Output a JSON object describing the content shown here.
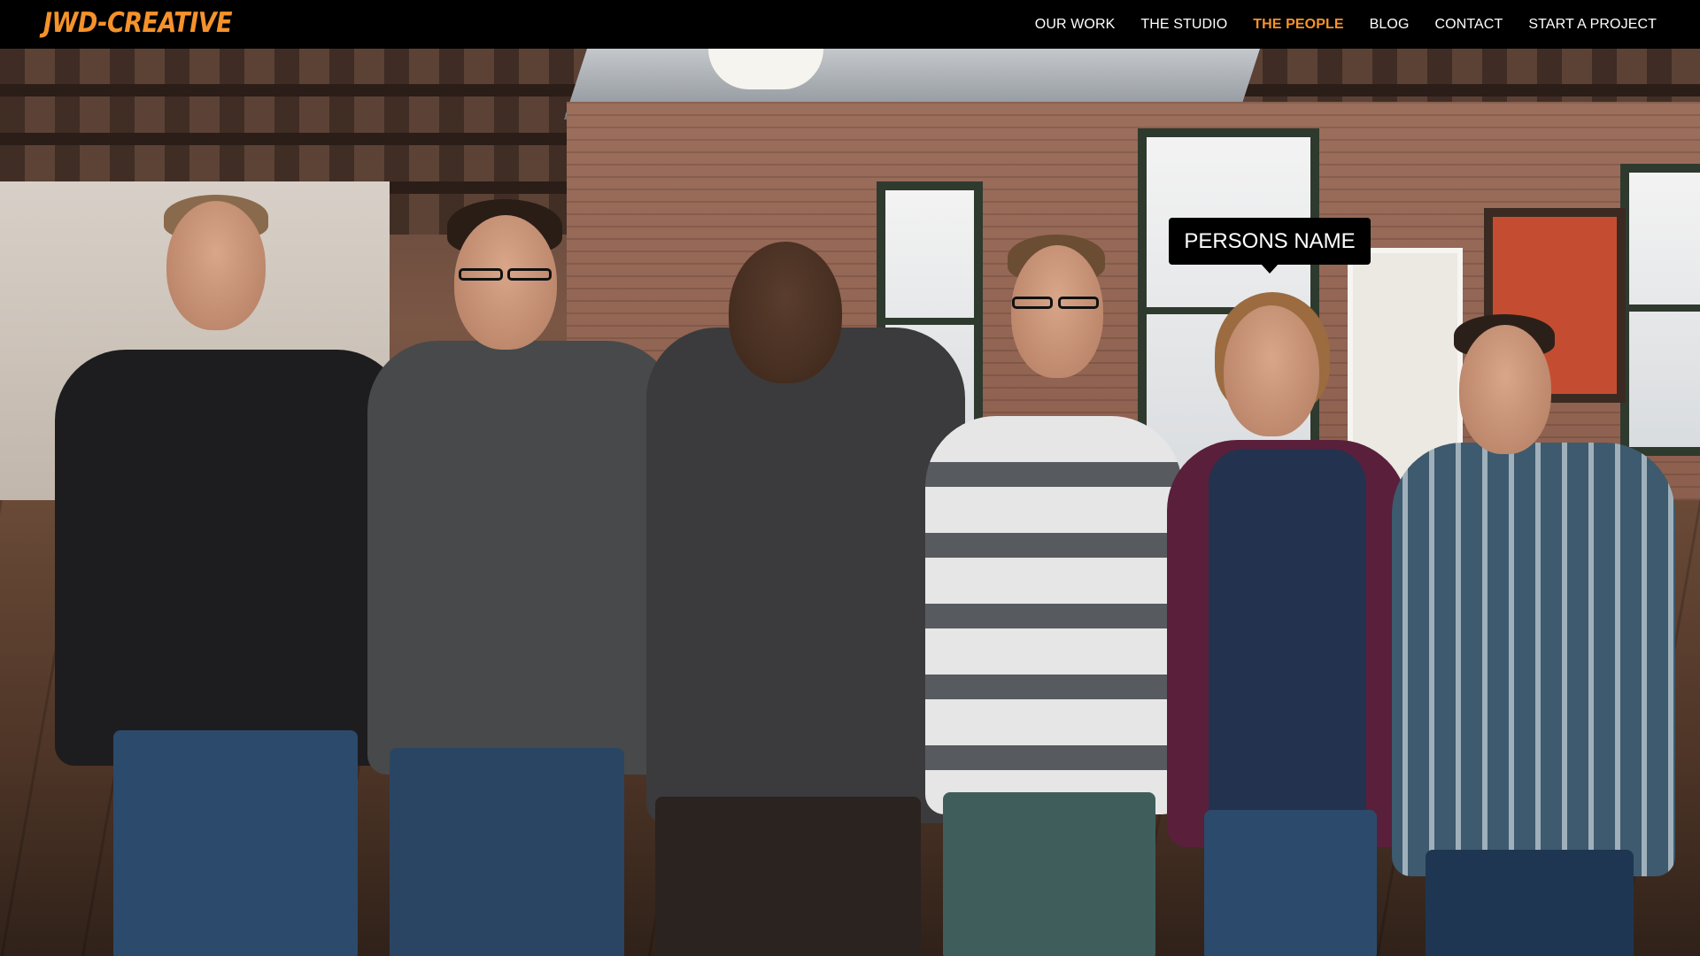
{
  "header": {
    "logo_text": "JWD-CREATIVE",
    "logo_color": "#f5922b",
    "nav": [
      {
        "label": "OUR WORK",
        "active": false
      },
      {
        "label": "THE STUDIO",
        "active": false
      },
      {
        "label": "THE PEOPLE",
        "active": true
      },
      {
        "label": "BLOG",
        "active": false
      },
      {
        "label": "CONTACT",
        "active": false
      },
      {
        "label": "START A PROJECT",
        "active": false
      }
    ],
    "active_color": "#f5922b",
    "nav_color": "#ffffff"
  },
  "tooltip": {
    "label": "PERSONS NAME"
  },
  "people_count": 6
}
